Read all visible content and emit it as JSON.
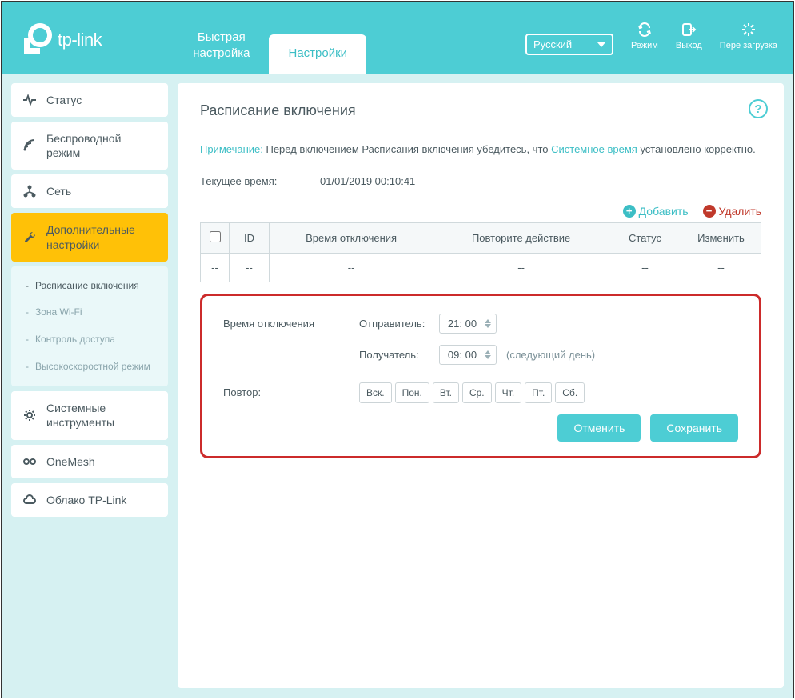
{
  "brand": "tp-link",
  "header": {
    "tabs": [
      {
        "label": "Быстрая\nнастройка",
        "active": false
      },
      {
        "label": "Настройки",
        "active": true
      }
    ],
    "language": "Русский",
    "actions": {
      "mode": "Режим",
      "logout": "Выход",
      "reboot": "Пере загрузка"
    }
  },
  "sidebar": {
    "items": [
      {
        "label": "Статус"
      },
      {
        "label": "Беспроводной режим"
      },
      {
        "label": "Сеть"
      },
      {
        "label": "Дополнительные настройки",
        "active": true
      },
      {
        "label": "Системные инструменты"
      },
      {
        "label": "OneMesh"
      },
      {
        "label": "Облако TP-Link"
      }
    ],
    "sub": [
      {
        "label": "Расписание включения",
        "active": true
      },
      {
        "label": "Зона Wi-Fi"
      },
      {
        "label": "Контроль доступа"
      },
      {
        "label": "Высокоскоростной режим"
      }
    ]
  },
  "page": {
    "title": "Расписание включения",
    "note_label": "Примечание:",
    "note_text_1": " Перед включением Расписания включения убедитесь, что ",
    "note_link": "Системное время",
    "note_text_2": " установлено корректно.",
    "current_time_label": "Текущее время:",
    "current_time_value": "01/01/2019 00:10:41",
    "add": "Добавить",
    "delete": "Удалить",
    "columns": {
      "id": "ID",
      "off": "Время отключения",
      "repeat": "Повторите действие",
      "status": "Статус",
      "edit": "Изменить"
    },
    "empty": "--",
    "form": {
      "off_time": "Время отключения",
      "from": "Отправитель:",
      "to": "Получатель:",
      "from_value": "21: 00",
      "to_value": "09: 00",
      "next_day": "(следующий день)",
      "repeat": "Повтор:",
      "days": [
        "Вск.",
        "Пон.",
        "Вт.",
        "Ср.",
        "Чт.",
        "Пт.",
        "Сб."
      ],
      "cancel": "Отменить",
      "save": "Сохранить"
    }
  }
}
